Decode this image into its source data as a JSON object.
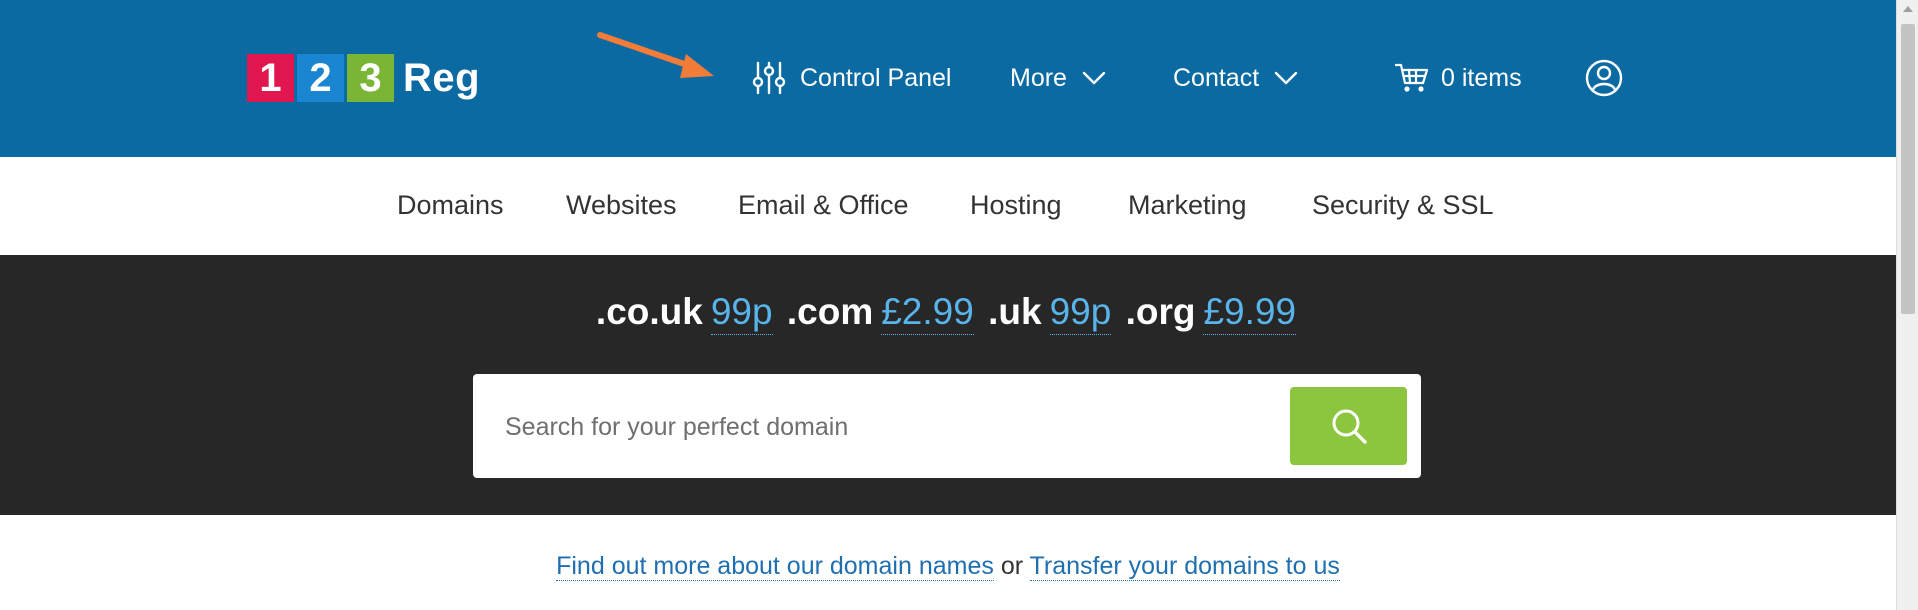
{
  "logo": {
    "digits": [
      "1",
      "2",
      "3"
    ],
    "word": "Reg",
    "colors": [
      "#e2164f",
      "#1a86d1",
      "#7ab536"
    ]
  },
  "header": {
    "control_panel": "Control Panel",
    "more": "More",
    "contact": "Contact",
    "cart": "0 items",
    "bg_color": "#0a6aa1"
  },
  "subnav": {
    "items": [
      "Domains",
      "Websites",
      "Email & Office",
      "Hosting",
      "Marketing",
      "Security & SSL"
    ]
  },
  "promo": {
    "tlds": [
      {
        "tld": ".co.uk",
        "price": "99p"
      },
      {
        "tld": ".com",
        "price": "£2.99"
      },
      {
        "tld": ".uk",
        "price": "99p"
      },
      {
        "tld": ".org",
        "price": "£9.99"
      }
    ],
    "price_color": "#58b4ea"
  },
  "search": {
    "placeholder": "Search for your perfect domain",
    "value": "",
    "button_color": "#8cc63f"
  },
  "footer": {
    "link1": "Find out more about our domain names",
    "connector": "or",
    "link2": "Transfer your domains to us"
  },
  "annotation": {
    "arrow_color": "#f27c38"
  },
  "icons": [
    "sliders-icon",
    "chevron-down-icon",
    "cart-icon",
    "user-icon",
    "search-icon"
  ]
}
